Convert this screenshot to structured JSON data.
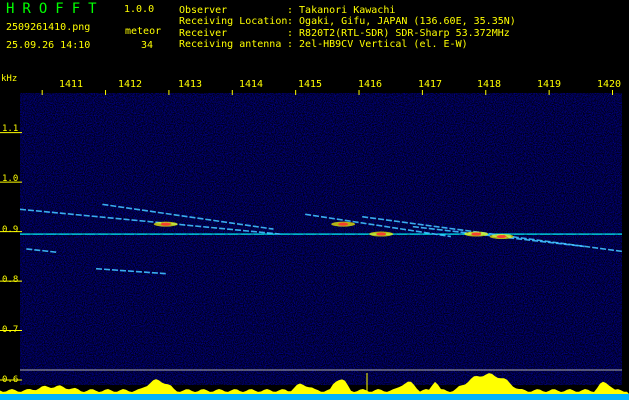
{
  "header": {
    "app_title": "HROFFT",
    "app_version": "1.0.0",
    "filename": "2509261410.png",
    "timestamp": "25.09.26 14:10",
    "meteor_label": "meteor",
    "meteor_count": "34"
  },
  "info": [
    {
      "key": "Observer",
      "value": ": Takanori Kawachi"
    },
    {
      "key": "Receiving Location",
      "value": ": Ogaki, Gifu, JAPAN (136.60E, 35.35N)"
    },
    {
      "key": "Receiver",
      "value": ": R820T2(RTL-SDR) SDR-Sharp 53.372MHz"
    },
    {
      "key": "Receiving antenna",
      "value": ": 2el-HB9CV Vertical (el. E-W)"
    }
  ],
  "colors": {
    "text": "#ffff00",
    "title": "#00ff00",
    "background": "#000000",
    "noise": "#000090",
    "signal_line": "#00ffff",
    "hot_signal": "#ff3030",
    "spectrum": "#ffff00",
    "baseline": "#00b4ff"
  },
  "chart_data": {
    "type": "heatmap",
    "y_unit_label": "kHz",
    "x_ticks": [
      "1411",
      "1412",
      "1413",
      "1414",
      "1415",
      "1416",
      "1417",
      "1418",
      "1419",
      "1420"
    ],
    "y_ticks": [
      "1.1",
      "1.0",
      "0.9",
      "0.8",
      "0.7",
      "0.6"
    ],
    "x_range": [
      1410.6,
      1420.1
    ],
    "y_range": [
      0.59,
      1.18
    ],
    "reference_line_khz": 0.895,
    "traces": [
      {
        "x": [
          1410.6,
          1420.1
        ],
        "y": [
          0.895,
          0.895
        ]
      },
      {
        "x": [
          1410.6,
          1414.7
        ],
        "y": [
          0.945,
          0.895
        ]
      },
      {
        "x": [
          1411.9,
          1414.6
        ],
        "y": [
          0.955,
          0.905
        ]
      },
      {
        "x": [
          1415.1,
          1417.4
        ],
        "y": [
          0.935,
          0.89
        ]
      },
      {
        "x": [
          1416.0,
          1420.1
        ],
        "y": [
          0.93,
          0.86
        ]
      },
      {
        "x": [
          1416.8,
          1419.5
        ],
        "y": [
          0.91,
          0.87
        ]
      },
      {
        "x": [
          1411.8,
          1412.9
        ],
        "y": [
          0.825,
          0.815
        ]
      },
      {
        "x": [
          1410.7,
          1411.2
        ],
        "y": [
          0.865,
          0.858
        ]
      }
    ],
    "hot_spots": [
      {
        "x": 1412.9,
        "y": 0.915
      },
      {
        "x": 1415.7,
        "y": 0.915
      },
      {
        "x": 1416.3,
        "y": 0.895
      },
      {
        "x": 1417.8,
        "y": 0.895
      },
      {
        "x": 1418.2,
        "y": 0.89
      }
    ]
  }
}
